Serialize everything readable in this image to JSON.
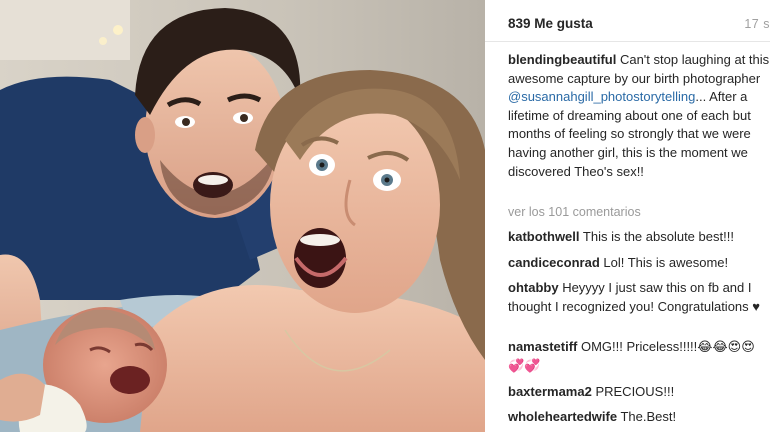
{
  "header": {
    "likes": "839 Me gusta",
    "time_ago": "17 s"
  },
  "caption": {
    "username": "blendingbeautiful",
    "text_before_mention": "Can't stop laughing at this awesome capture by our birth photographer",
    "mention": "@susannahgill_photostorytelling",
    "text_after_mention": "... After a lifetime of dreaming about one of each but months of feeling so strongly that we were having another girl, this is the moment we discovered Theo's sex!!"
  },
  "view_all_comments": "ver los 101 comentarios",
  "comments": [
    {
      "username": "katbothwell",
      "text": "This is the absolute best!!!"
    },
    {
      "username": "candiceconrad",
      "text": "Lol! This is awesome!"
    },
    {
      "username": "ohtabby",
      "text": "Heyyyy I just saw this on fb and I thought I recognized you! Congratulations ♥"
    },
    {
      "username": "namastetiff",
      "text": "OMG!!! Priceless!!!!!😂😂😍😍 💞💞"
    },
    {
      "username": "baxtermama2",
      "text": "PRECIOUS!!!"
    },
    {
      "username": "wholeheartedwife",
      "text": "The.Best!"
    }
  ],
  "icons": {
    "heart": "heart-icon"
  }
}
